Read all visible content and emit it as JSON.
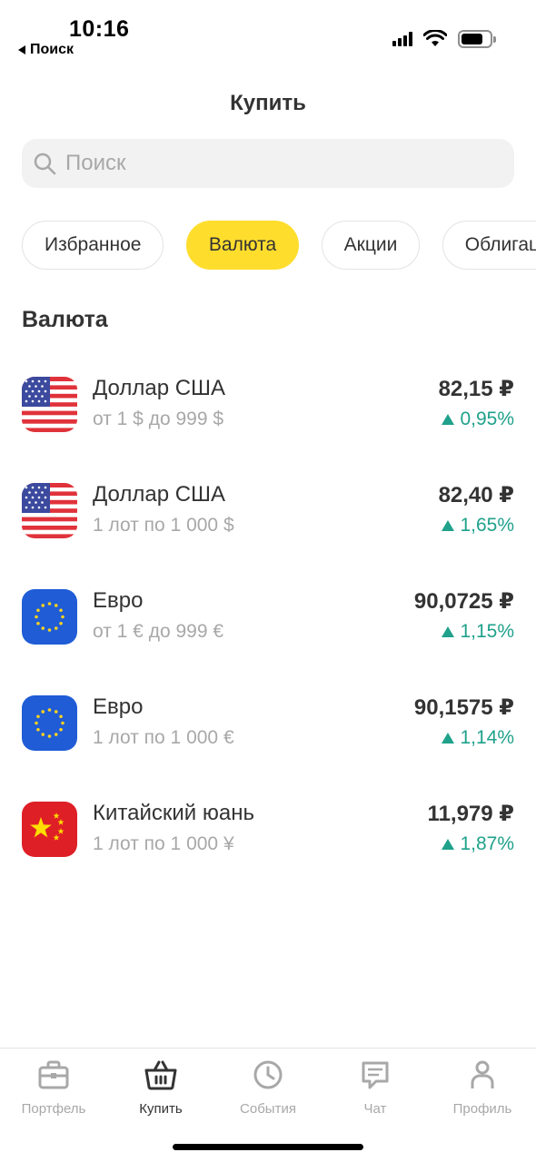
{
  "status_bar": {
    "time": "10:16",
    "back_label": "Поиск"
  },
  "header": {
    "title": "Купить"
  },
  "search": {
    "placeholder": "Поиск"
  },
  "chips": [
    {
      "label": "Избранное",
      "active": false
    },
    {
      "label": "Валюта",
      "active": true
    },
    {
      "label": "Акции",
      "active": false
    },
    {
      "label": "Облигации",
      "active": false
    }
  ],
  "section": {
    "title": "Валюта"
  },
  "items": [
    {
      "icon": "us-flag-icon",
      "name": "Доллар США",
      "subtitle": "от 1 $ до 999 $",
      "price": "82,15 ₽",
      "change": "0,95%"
    },
    {
      "icon": "us-flag-icon",
      "name": "Доллар США",
      "subtitle": "1 лот по 1 000 $",
      "price": "82,40 ₽",
      "change": "1,65%"
    },
    {
      "icon": "eu-flag-icon",
      "name": "Евро",
      "subtitle": "от 1 € до 999 €",
      "price": "90,0725 ₽",
      "change": "1,15%"
    },
    {
      "icon": "eu-flag-icon",
      "name": "Евро",
      "subtitle": "1 лот по 1 000 €",
      "price": "90,1575 ₽",
      "change": "1,14%"
    },
    {
      "icon": "china-flag-icon",
      "name": "Китайский юань",
      "subtitle": "1 лот по 1 000 ¥",
      "price": "11,979 ₽",
      "change": "1,87%"
    }
  ],
  "tabbar": [
    {
      "label": "Портфель",
      "icon": "briefcase-icon",
      "active": false
    },
    {
      "label": "Купить",
      "icon": "basket-icon",
      "active": true
    },
    {
      "label": "События",
      "icon": "clock-icon",
      "active": false
    },
    {
      "label": "Чат",
      "icon": "chat-icon",
      "active": false
    },
    {
      "label": "Профиль",
      "icon": "profile-icon",
      "active": false
    }
  ],
  "colors": {
    "accent_yellow": "#ffdd2d",
    "positive_green": "#1fa18b",
    "text_primary": "#333333",
    "text_secondary": "#a8a8a8"
  }
}
